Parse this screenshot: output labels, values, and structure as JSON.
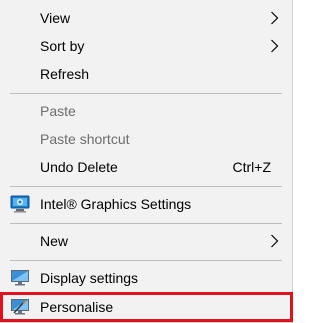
{
  "menu": {
    "items": [
      {
        "label": "View",
        "has_submenu": true,
        "enabled": true
      },
      {
        "label": "Sort by",
        "has_submenu": true,
        "enabled": true
      },
      {
        "label": "Refresh",
        "has_submenu": false,
        "enabled": true
      },
      {
        "label": "Paste",
        "has_submenu": false,
        "enabled": false
      },
      {
        "label": "Paste shortcut",
        "has_submenu": false,
        "enabled": false
      },
      {
        "label": "Undo Delete",
        "shortcut": "Ctrl+Z",
        "has_submenu": false,
        "enabled": true
      },
      {
        "label": "Intel® Graphics Settings",
        "icon": "intel-graphics-icon",
        "has_submenu": false,
        "enabled": true
      },
      {
        "label": "New",
        "has_submenu": true,
        "enabled": true
      },
      {
        "label": "Display settings",
        "icon": "display-settings-icon",
        "has_submenu": false,
        "enabled": true
      },
      {
        "label": "Personalise",
        "icon": "personalise-icon",
        "has_submenu": false,
        "enabled": true,
        "highlighted": true
      }
    ]
  },
  "colors": {
    "menu_background": "#f2f2f2",
    "separator": "#bdbdbd",
    "disabled_text": "#6d6d6d",
    "highlight_outline": "#e0121e"
  }
}
